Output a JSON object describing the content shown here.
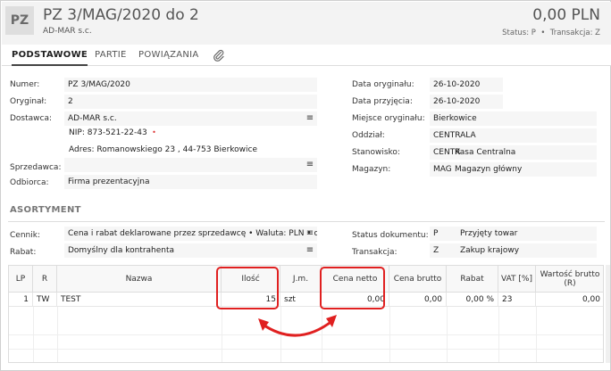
{
  "header": {
    "icon_text": "PZ",
    "title": "PZ 3/MAG/2020 do 2",
    "subtitle": "AD-MAR s.c.",
    "amount": "0,00 PLN",
    "status_label": "Status:",
    "status_value": "P",
    "transaction_label": "Transakcja:",
    "transaction_value": "Z"
  },
  "tabs": [
    {
      "label": "PODSTAWOWE"
    },
    {
      "label": "PARTIE"
    },
    {
      "label": "POWIĄZANIA"
    }
  ],
  "form": {
    "numer_label": "Numer:",
    "numer_value": "PZ 3/MAG/2020",
    "oryginal_label": "Oryginał:",
    "oryginal_value": "2",
    "dostawca_label": "Dostawca:",
    "dostawca_value": "AD-MAR s.c.",
    "nip_label": "NIP:",
    "nip_value": "873-521-22-43",
    "adres_label": "Adres:",
    "adres_value": "Romanowskiego 23 , 44-753 Bierkowice",
    "sprzedawca_label": "Sprzedawca:",
    "sprzedawca_value": "",
    "odbiorca_label": "Odbiorca:",
    "odbiorca_value": "Firma prezentacyjna",
    "data_oryginalu_label": "Data oryginału:",
    "data_oryginalu_value": "26-10-2020",
    "data_przyjecia_label": "Data przyjęcia:",
    "data_przyjecia_value": "26-10-2020",
    "miejsce_label": "Miejsce oryginału:",
    "miejsce_value": "Bierkowice",
    "oddzial_label": "Oddział:",
    "oddzial_value": "CENTRALA",
    "stanowisko_label": "Stanowisko:",
    "stanowisko_code": "CENTR",
    "stanowisko_name": "Kasa Centralna",
    "magazyn_label": "Magazyn:",
    "magazyn_code": "MAG",
    "magazyn_name": "Magazyn główny"
  },
  "asortyment": {
    "section_title": "ASORTYMENT",
    "cennik_label": "Cennik:",
    "cennik_value": "Cena i rabat deklarowane przez sprzedawcę • Waluta: PLN • od net",
    "rabat_label": "Rabat:",
    "rabat_value": "Domyślny dla kontrahenta",
    "status_dok_label": "Status dokumentu:",
    "status_dok_code": "P",
    "status_dok_name": "Przyjęty towar",
    "transakcja_label": "Transakcja:",
    "transakcja_code": "Z",
    "transakcja_name": "Zakup krajowy"
  },
  "table": {
    "columns": {
      "lp": "LP",
      "r": "R",
      "nazwa": "Nazwa",
      "ilosc": "Ilość",
      "jm": "J.m.",
      "cena_netto": "Cena netto",
      "cena_brutto": "Cena brutto",
      "rabat": "Rabat",
      "vat": "VAT [%]",
      "wartosc_brutto": "Wartość brutto (R)"
    },
    "rows": [
      {
        "lp": "1",
        "r": "TW",
        "nazwa": "TEST",
        "ilosc": "15",
        "jm": "szt",
        "cena_netto": "0,00",
        "cena_brutto": "0,00",
        "rabat": "0,00 %",
        "vat": "23",
        "wartosc_brutto": "0,00"
      }
    ]
  },
  "colors": {
    "highlight": "#e02020",
    "header_bg": "#f3f3f3",
    "field_bg": "#f6f6f6"
  }
}
